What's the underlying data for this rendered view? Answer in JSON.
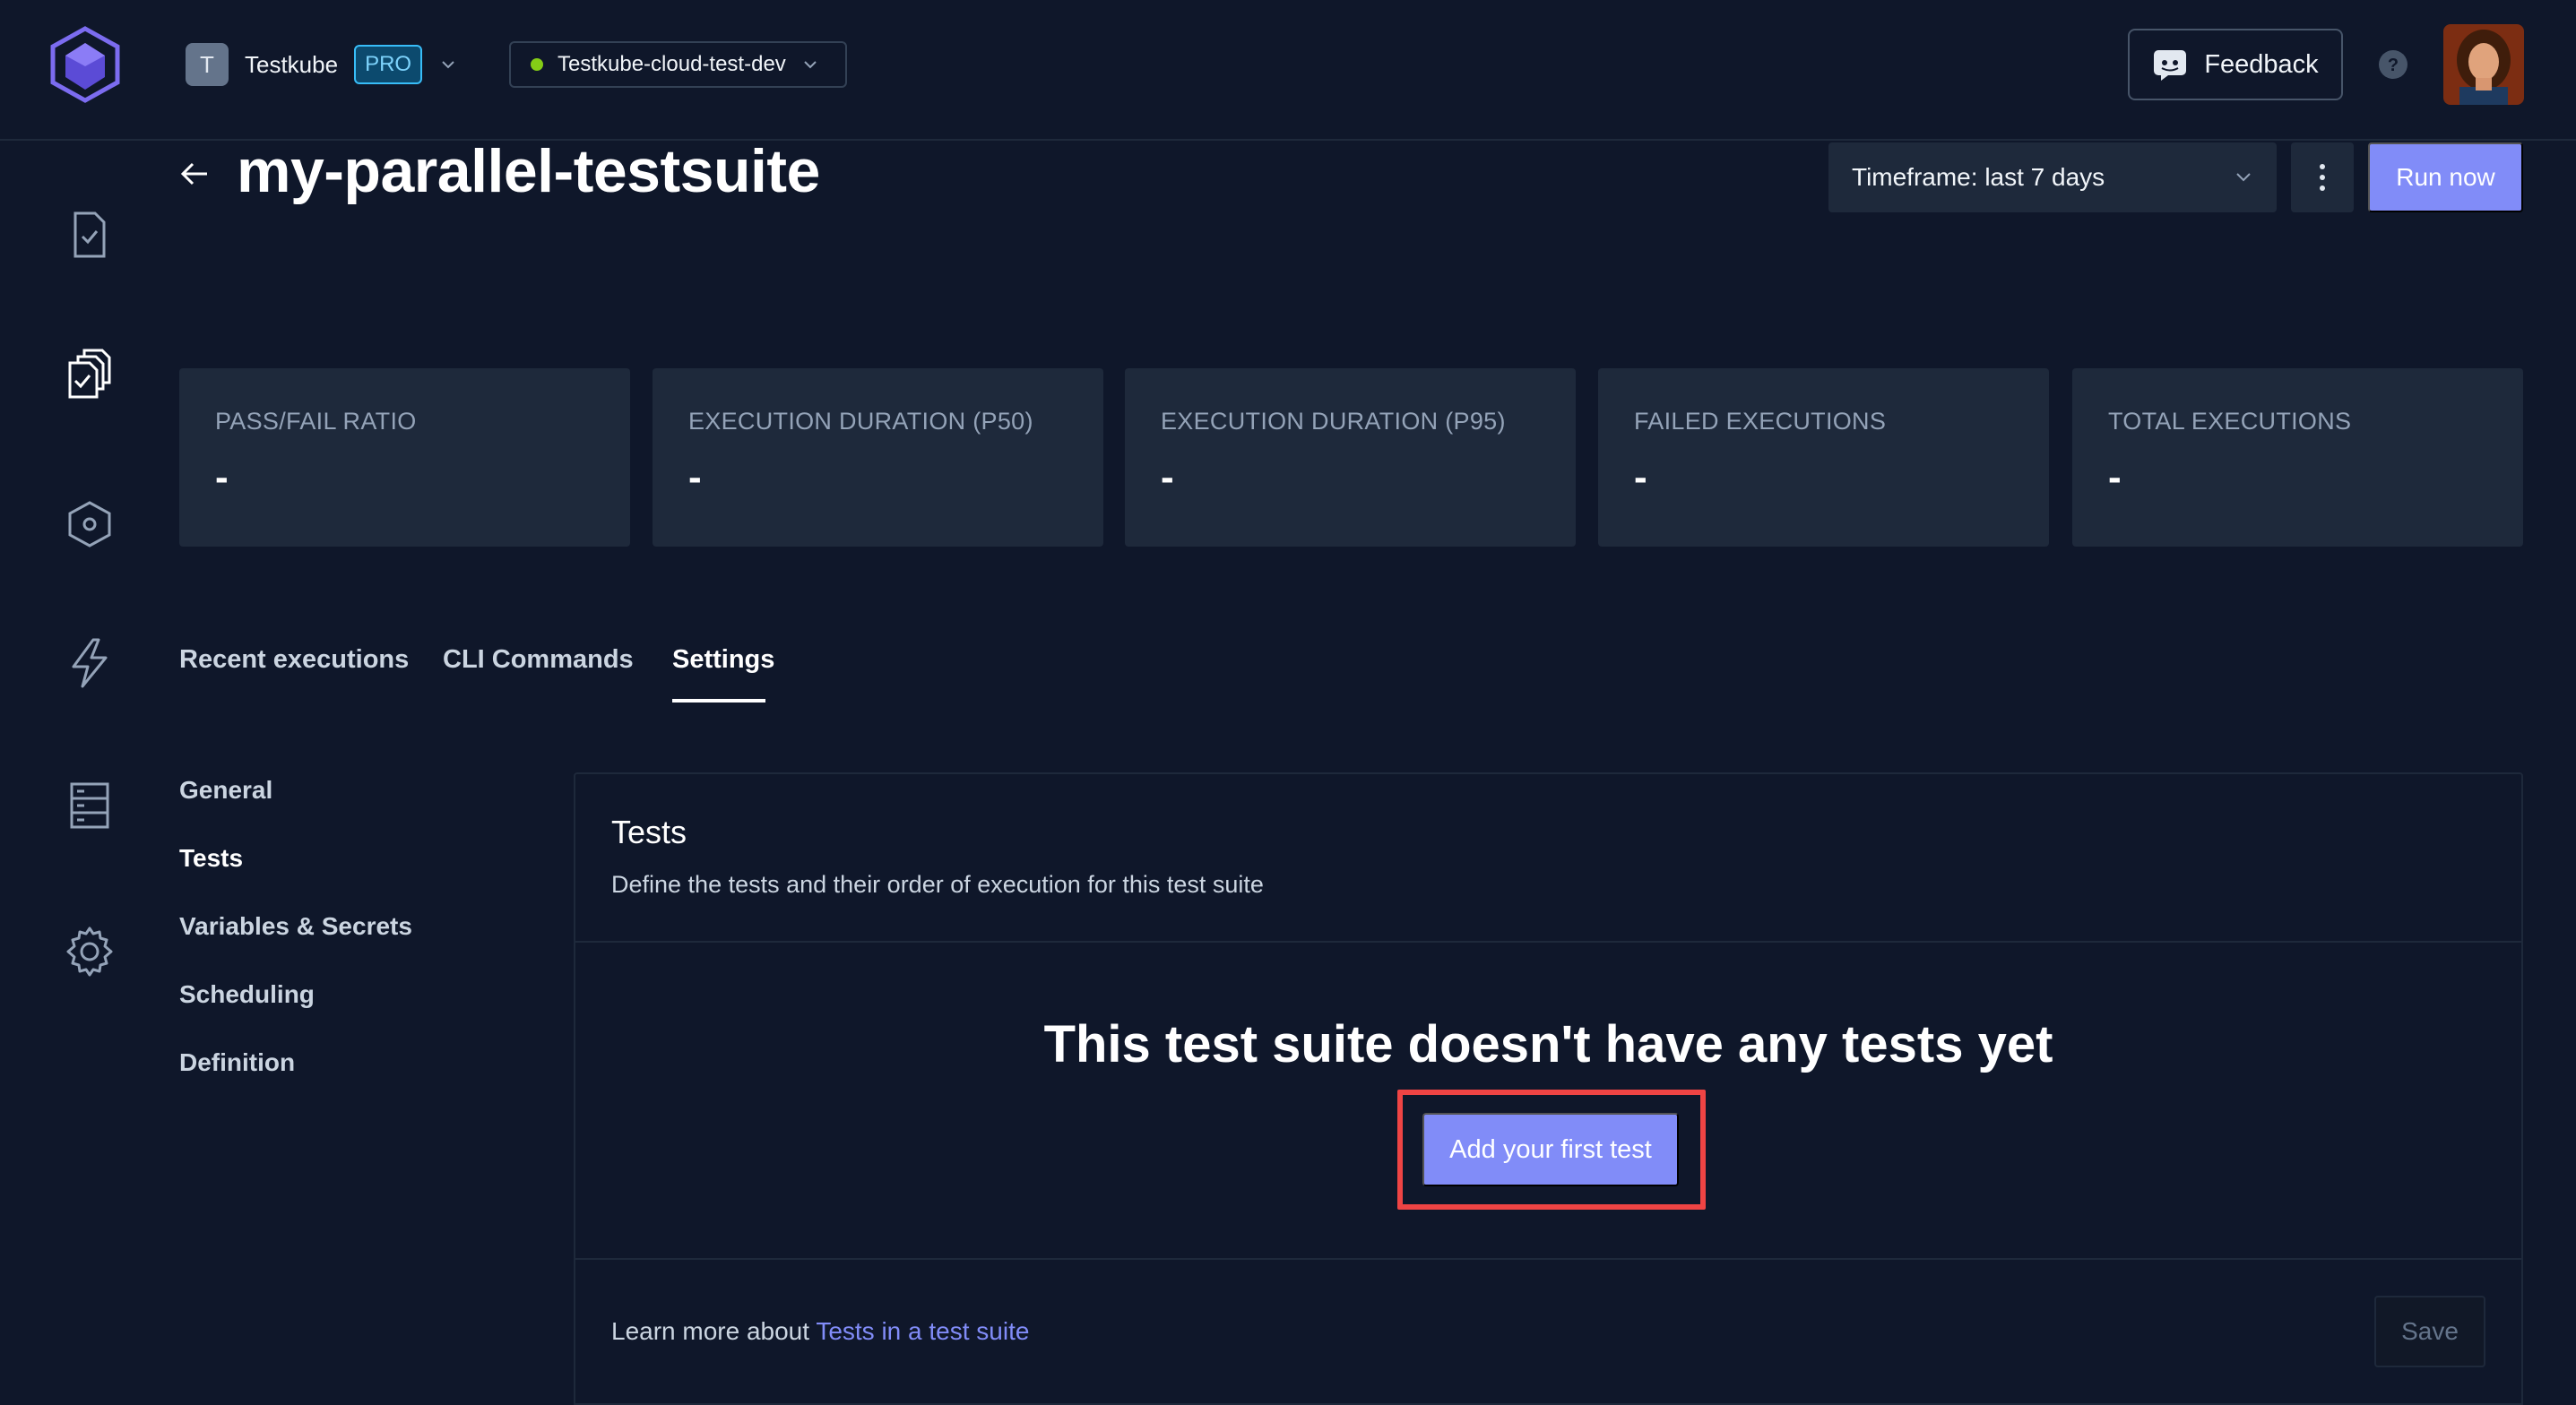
{
  "header": {
    "org_initial": "T",
    "org_name": "Testkube",
    "plan_badge": "PRO",
    "environment": "Testkube-cloud-test-dev",
    "environment_status_color": "#84cc16",
    "feedback_label": "Feedback"
  },
  "sidebar": {
    "items": [
      {
        "icon": "test-file-icon"
      },
      {
        "icon": "test-suites-icon"
      },
      {
        "icon": "shield-gear-icon"
      },
      {
        "icon": "lightning-icon"
      },
      {
        "icon": "server-list-icon"
      },
      {
        "icon": "gear-icon"
      }
    ]
  },
  "page": {
    "title": "my-parallel-testsuite",
    "timeframe": "Timeframe: last 7 days",
    "run_now": "Run now"
  },
  "stats": [
    {
      "label": "PASS/FAIL RATIO",
      "value": "-"
    },
    {
      "label": "EXECUTION DURATION (P50)",
      "value": "-"
    },
    {
      "label": "EXECUTION DURATION (P95)",
      "value": "-"
    },
    {
      "label": "FAILED EXECUTIONS",
      "value": "-"
    },
    {
      "label": "TOTAL EXECUTIONS",
      "value": "-"
    }
  ],
  "tabs": [
    {
      "label": "Recent executions"
    },
    {
      "label": "CLI Commands"
    },
    {
      "label": "Settings"
    }
  ],
  "settings_nav": [
    {
      "label": "General"
    },
    {
      "label": "Tests"
    },
    {
      "label": "Variables & Secrets"
    },
    {
      "label": "Scheduling"
    },
    {
      "label": "Definition"
    }
  ],
  "panel": {
    "title": "Tests",
    "description": "Define the tests and their order of execution for this test suite",
    "empty_title": "This test suite doesn't have any tests yet",
    "add_button": "Add your first test",
    "learn_prefix": "Learn more about ",
    "learn_link": "Tests in a test suite",
    "save": "Save"
  },
  "colors": {
    "accent": "#818cf8",
    "highlight": "#ef4444",
    "background": "#0f172a",
    "card": "#1e293b"
  }
}
